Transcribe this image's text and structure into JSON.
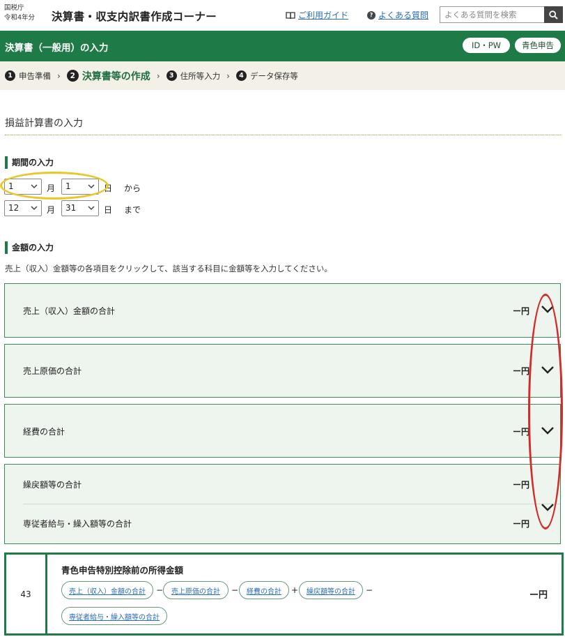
{
  "header": {
    "agency": "国税庁",
    "year": "令和4年分",
    "title": "決算書・収支内訳書作成コーナー",
    "guide_link": "ご利用ガイド",
    "faq_link": "よくある質問",
    "search_placeholder": "よくある質問を検索"
  },
  "band": {
    "title": "決算書（一般用）の入力",
    "id_pw_button": "ID・PW",
    "blue_return_button": "青色申告"
  },
  "steps": [
    {
      "num": "1",
      "label": "申告準備",
      "active": false
    },
    {
      "num": "2",
      "label": "決算書等の作成",
      "active": true
    },
    {
      "num": "3",
      "label": "住所等入力",
      "active": false
    },
    {
      "num": "4",
      "label": "データ保存等",
      "active": false
    }
  ],
  "page": {
    "heading": "損益計算書の入力",
    "period_section": "期間の入力",
    "period_from": {
      "month": "1",
      "day": "1",
      "month_unit": "月",
      "day_unit": "日",
      "suffix": "から"
    },
    "period_to": {
      "month": "12",
      "day": "31",
      "month_unit": "月",
      "day_unit": "日",
      "suffix": "まで"
    },
    "amount_section": "金額の入力",
    "instruction": "売上（収入）金額等の各項目をクリックして、該当する科目に金額等を入力してください。"
  },
  "accordions": [
    {
      "label": "売上（収入）金額の合計",
      "value": "ー円"
    },
    {
      "label": "売上原価の合計",
      "value": "ー円"
    },
    {
      "label": "経費の合計",
      "value": "ー円"
    },
    {
      "label": "繰戻額等の合計",
      "value": "ー円"
    },
    {
      "label": "専従者給与・繰入額等の合計",
      "value": "ー円"
    }
  ],
  "formula": {
    "number": "43",
    "title": "青色申告特別控除前の所得金額",
    "chips": [
      "売上（収入）金額の合計",
      "売上原価の合計",
      "経費の合計",
      "繰戻額等の合計",
      "専従者給与・繰入額等の合計"
    ],
    "ops": [
      "−",
      "−",
      "+",
      "−"
    ],
    "result": "ー円"
  },
  "colors": {
    "brand_green": "#1e7a46",
    "steps_bg": "#f3f1e7",
    "accordion_bg": "#eef4ee",
    "link_blue": "#2a6db5",
    "annotation_yellow": "#e8c72a",
    "annotation_red": "#d32a2a"
  }
}
